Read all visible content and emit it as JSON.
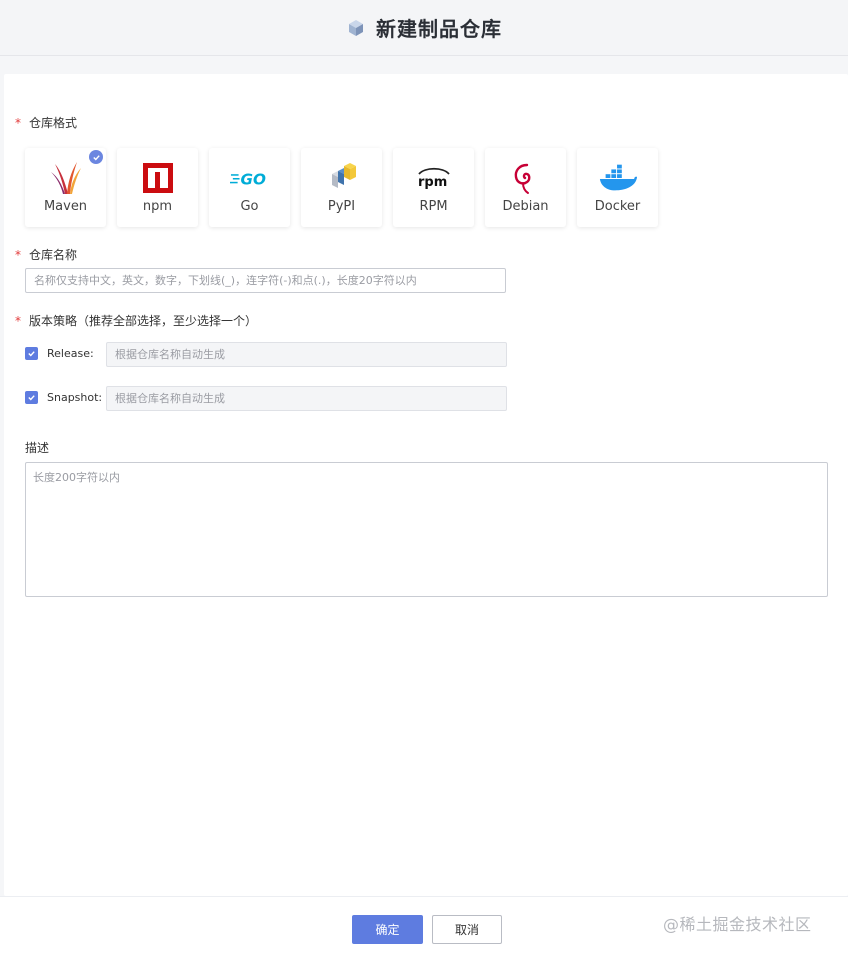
{
  "header": {
    "title": "新建制品仓库"
  },
  "form": {
    "format_label": "仓库格式",
    "formats": [
      {
        "name": "Maven",
        "selected": true
      },
      {
        "name": "npm",
        "selected": false
      },
      {
        "name": "Go",
        "selected": false
      },
      {
        "name": "PyPI",
        "selected": false
      },
      {
        "name": "RPM",
        "selected": false
      },
      {
        "name": "Debian",
        "selected": false
      },
      {
        "name": "Docker",
        "selected": false
      }
    ],
    "name_label": "仓库名称",
    "name_placeholder": "名称仅支持中文，英文，数字，下划线(_)，连字符(-)和点(.)，长度20字符以内",
    "version_label": "版本策略（推荐全部选择，至少选择一个）",
    "release": {
      "label": "Release:",
      "checked": true,
      "placeholder": "根据仓库名称自动生成"
    },
    "snapshot": {
      "label": "Snapshot:",
      "checked": true,
      "placeholder": "根据仓库名称自动生成"
    },
    "desc_label": "描述",
    "desc_placeholder": "长度200字符以内",
    "required_mark": "*"
  },
  "footer": {
    "confirm": "确定",
    "cancel": "取消",
    "watermark": "@稀土掘金技术社区"
  },
  "colors": {
    "accent": "#5e7ce0",
    "required": "#e23a3a"
  }
}
